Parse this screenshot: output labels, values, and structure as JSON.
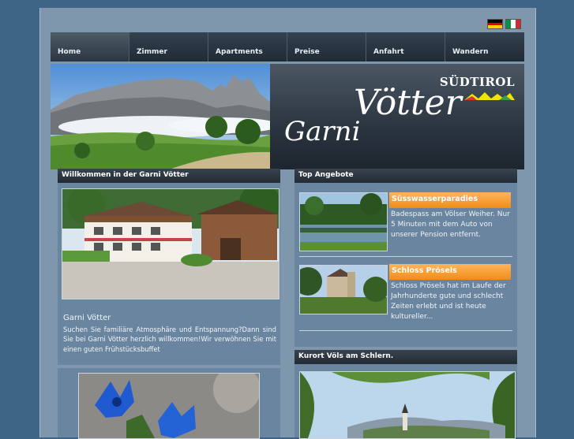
{
  "languages": [
    {
      "name": "flag-de-icon",
      "colors": [
        "#000000",
        "#dd0000",
        "#ffce00"
      ]
    },
    {
      "name": "flag-it-icon",
      "colors": [
        "#009246",
        "#ffffff",
        "#ce2b37"
      ]
    }
  ],
  "nav": {
    "items": [
      {
        "label": "Home",
        "active": true
      },
      {
        "label": "Zimmer"
      },
      {
        "label": "Apartments"
      },
      {
        "label": "Preise"
      },
      {
        "label": "Anfahrt"
      },
      {
        "label": "Wandern"
      }
    ]
  },
  "header": {
    "logo_garni": "Garni",
    "logo_votter": "Vötter",
    "region_brand": "SÜDTIROL"
  },
  "welcome": {
    "heading": "Willkommen in der Garni Vötter",
    "name": "Garni Vötter",
    "text": "Suchen Sie familiäre Atmosphäre und Entspannung?Dann sind Sie bei Garni Vötter herzlich willkommen!Wir verwöhnen Sie mit einen guten Frühstücksbuffet"
  },
  "offers": {
    "heading": "Top Angebote",
    "items": [
      {
        "title": "Süsswasserparadies",
        "text": "Badespass am Völser Weiher. Nur 5 Minuten mit dem Auto von unserer Pension entfernt."
      },
      {
        "title": "Schloss Prösels",
        "text": "Schloss Prösels hat im Laufe der Jahrhunderte gute und schlecht Zeiten erlebt und ist heute kultureller..."
      }
    ]
  },
  "kurort": {
    "heading": "Kurort Völs am Schlern."
  },
  "colors": {
    "background": "#3e6585",
    "content": "#7f97ad",
    "panel": "#6985a0",
    "nav": "#1f2a34",
    "offer_accent": "#f08d18"
  }
}
